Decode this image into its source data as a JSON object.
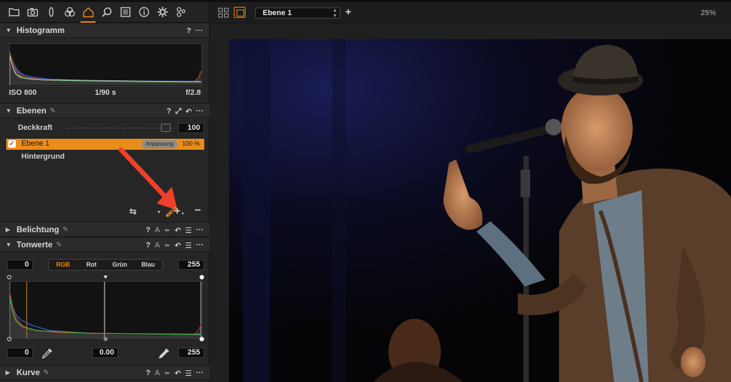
{
  "toolbar": {
    "tabs": [
      {
        "icon": "folder-icon"
      },
      {
        "icon": "camera-icon"
      },
      {
        "icon": "lens-icon"
      },
      {
        "icon": "color-circles-icon"
      },
      {
        "icon": "exposure-icon",
        "active": true
      },
      {
        "icon": "search-icon"
      },
      {
        "icon": "details-icon"
      },
      {
        "icon": "info-icon"
      },
      {
        "icon": "gear-icon"
      },
      {
        "icon": "batch-icon"
      }
    ]
  },
  "histogram": {
    "title": "Histogramm",
    "help": "?",
    "more": "···",
    "iso": "ISO 800",
    "shutter": "1/90 s",
    "aperture": "f/2.8"
  },
  "layers": {
    "title": "Ebenen",
    "help": "?",
    "more": "···",
    "opacity_label": "Deckkraft",
    "opacity_value": "100",
    "active_layer": {
      "name": "Ebene 1",
      "badge": "Anpassung",
      "percent": "100 %"
    },
    "background_layer": "Hintergrund"
  },
  "exposure": {
    "title": "Belichtung",
    "help": "?",
    "auto": "A"
  },
  "levels": {
    "title": "Tonwerte",
    "help": "?",
    "auto": "A",
    "input_low": "0",
    "input_high": "255",
    "channels": [
      "RGB",
      "Rot",
      "Grün",
      "Blau"
    ],
    "active_channel": "RGB",
    "output_low": "0",
    "midtone": "0.00",
    "output_high": "255"
  },
  "curve": {
    "title": "Kurve",
    "help": "?",
    "auto": "A"
  },
  "viewer": {
    "layer_select": "Ebene 1",
    "add_layer": "+",
    "zoom": "25%"
  },
  "colors": {
    "accent": "#f08a16",
    "panel": "#262626",
    "annotation_arrow": "#f0402a"
  }
}
